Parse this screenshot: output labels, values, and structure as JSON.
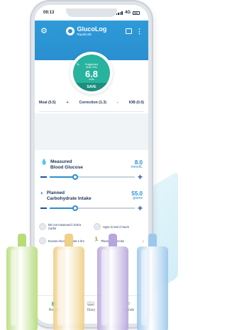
{
  "status_bar": {
    "time": "09:13",
    "network": "4G"
  },
  "app": {
    "brand_name": "GlucoLog",
    "brand_sub": "RapidCalc"
  },
  "dose": {
    "suggest_label_line1": "Suggested",
    "suggest_label_line2": "dose RAI",
    "value": "6.8",
    "units": "units",
    "save_label": "SAVE"
  },
  "formula": {
    "meal": "Meal (5.5)",
    "plus": "+",
    "correction": "Correction (1.3)",
    "minus": "-",
    "iob": "IOB (0.0)"
  },
  "glucose": {
    "label_line1": "Measured",
    "label_line2": "Blood Glucose",
    "value": "8.0",
    "unit": "mmol/L",
    "slider_fraction": 0.3
  },
  "carbs": {
    "label_line1": "Planned",
    "label_line2": "Carbohydrate Intake",
    "value": "55.0",
    "unit": "grams",
    "slider_fraction": 0.3
  },
  "options": {
    "bg_not_measured": "BG not measured / Extra Carbs",
    "hypo": "Hypo in last 4 hours",
    "alcohol": "Excess Alcohol in last 4 hrs",
    "exercise": "Planned Exercise"
  },
  "nav": {
    "result": "Result",
    "diary": "Diary",
    "stats": "Trends"
  },
  "colors": {
    "primary": "#2a8fd0",
    "dose_green": "#27b39d",
    "needle_green": "#b7dd7a",
    "needle_yellow": "#f0cf86",
    "needle_purple": "#b7a6dd",
    "needle_blue": "#9cc8ec"
  }
}
